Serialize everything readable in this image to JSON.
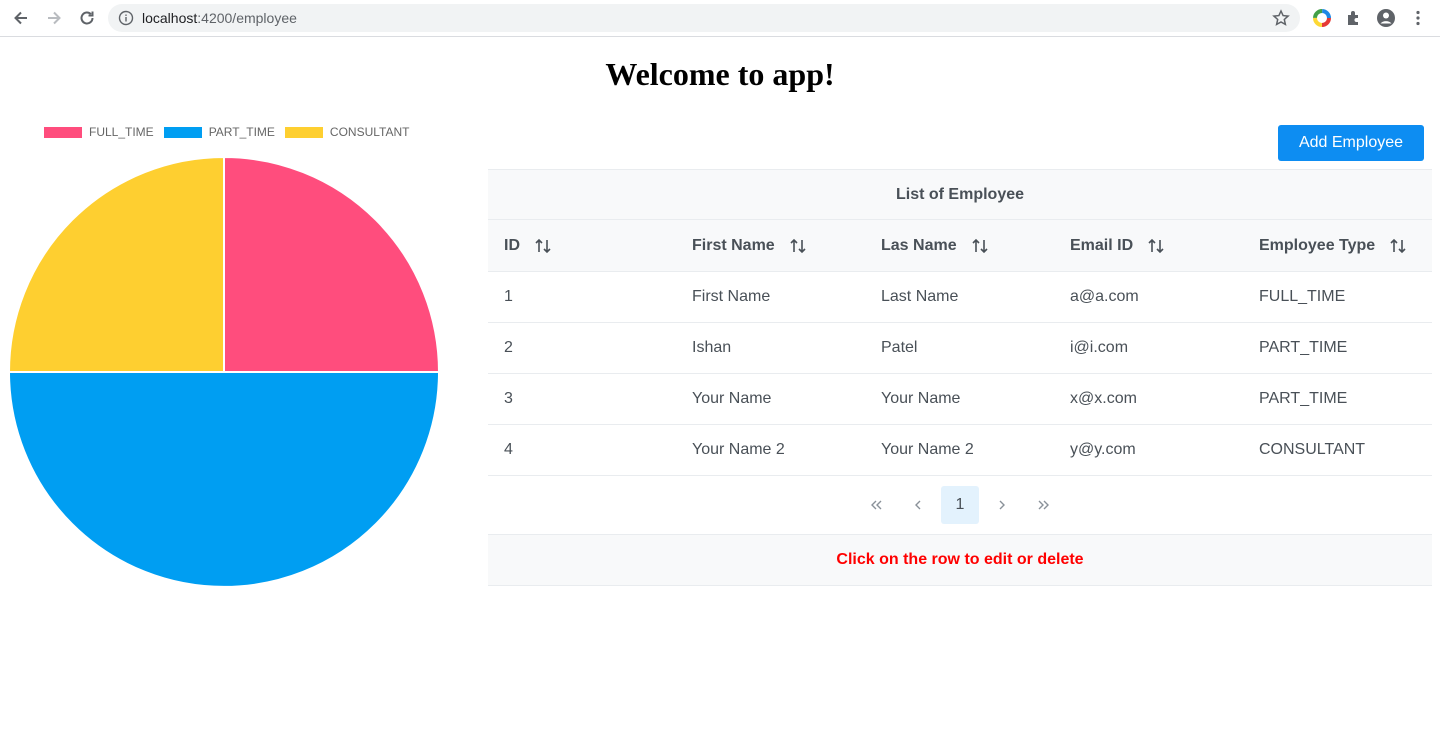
{
  "browser": {
    "url_host": "localhost",
    "url_path": ":4200/employee"
  },
  "page": {
    "title": "Welcome to app!",
    "add_button_label": "Add Employee"
  },
  "chart_data": {
    "type": "pie",
    "categories": [
      "FULL_TIME",
      "PART_TIME",
      "CONSULTANT"
    ],
    "values": [
      1,
      2,
      1
    ],
    "colors": [
      "#ff4d7d",
      "#009ef2",
      "#fecf30"
    ],
    "legend": "top"
  },
  "table": {
    "caption": "List of Employee",
    "columns": [
      "ID",
      "First Name",
      "Las Name",
      "Email ID",
      "Employee Type"
    ],
    "rows": [
      [
        "1",
        "First Name",
        "Last Name",
        "a@a.com",
        "FULL_TIME"
      ],
      [
        "2",
        "Ishan",
        "Patel",
        "i@i.com",
        "PART_TIME"
      ],
      [
        "3",
        "Your Name",
        "Your Name",
        "x@x.com",
        "PART_TIME"
      ],
      [
        "4",
        "Your Name 2",
        "Your Name 2",
        "y@y.com",
        "CONSULTANT"
      ]
    ],
    "current_page": "1",
    "footer": "Click on the row to edit or delete"
  },
  "icons": {
    "back": "arrow-left-icon",
    "forward": "arrow-right-icon",
    "reload": "reload-icon",
    "info": "info-icon",
    "star": "star-icon",
    "sort": "sort-icon"
  }
}
